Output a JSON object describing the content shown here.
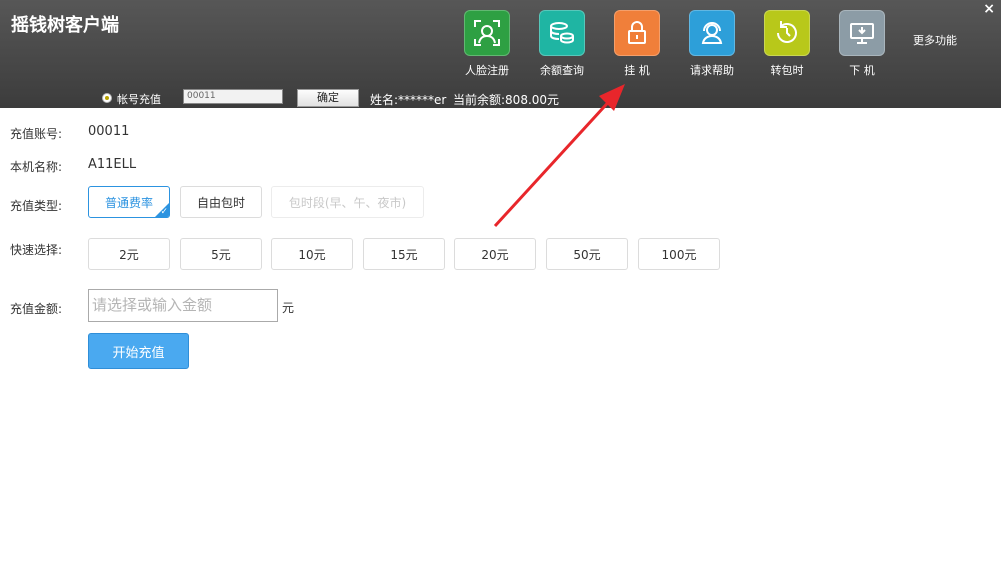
{
  "header": {
    "title": "摇钱树客户端",
    "close": "×",
    "more_label": "更多功能",
    "tools": [
      {
        "label": "人脸注册",
        "icon": "face-scan-icon",
        "color": "#2ea043"
      },
      {
        "label": "余额查询",
        "icon": "coins-icon",
        "color": "#1fb5a3"
      },
      {
        "label": "挂 机",
        "icon": "lock-icon",
        "color": "#f07f3a"
      },
      {
        "label": "请求帮助",
        "icon": "support-agent-icon",
        "color": "#2d9fd9"
      },
      {
        "label": "转包时",
        "icon": "clock-refresh-icon",
        "color": "#b8c81a"
      },
      {
        "label": "下 机",
        "icon": "monitor-icon",
        "color": "#8c9ca6"
      }
    ]
  },
  "toolbar": {
    "radio_label": "帐号充值",
    "account_value": "00011",
    "confirm_label": "确定",
    "name_info": "姓名:******er",
    "balance_info": "当前余额:808.00元"
  },
  "form": {
    "account_label": "充值账号:",
    "account_value": "00011",
    "machine_label": "本机名称:",
    "machine_value": "A11ELL",
    "type_label": "充值类型:",
    "types": [
      {
        "label": "普通费率",
        "state": "selected"
      },
      {
        "label": "自由包时",
        "state": "normal"
      },
      {
        "label": "包时段(早、午、夜市)",
        "state": "disabled"
      }
    ],
    "quick_label": "快速选择:",
    "quick_options": [
      "2元",
      "5元",
      "10元",
      "15元",
      "20元",
      "50元",
      "100元"
    ],
    "amount_label": "充值金额:",
    "amount_placeholder": "请选择或输入金额",
    "amount_unit": "元",
    "start_label": "开始充值"
  },
  "annotation": {
    "color": "#e8262b"
  }
}
